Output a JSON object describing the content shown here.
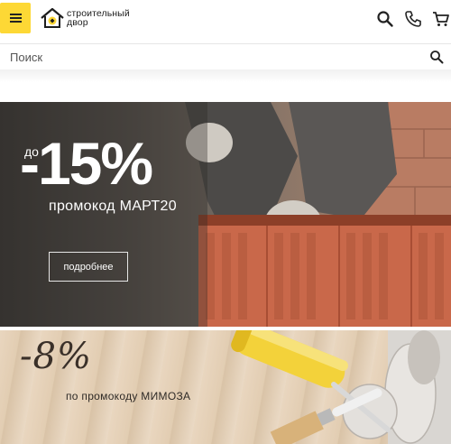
{
  "header": {
    "menu_icon": "hamburger-menu-icon",
    "logo_line1": "строительный",
    "logo_line2": "двор",
    "icons": [
      "search-icon",
      "phone-icon",
      "cart-icon"
    ],
    "accent_color": "#fdd835"
  },
  "search": {
    "placeholder": "Поиск",
    "icon": "search-icon"
  },
  "banner1": {
    "prefix": "до",
    "discount": "-15%",
    "promo": "промокод МАРТ20",
    "button_label": "подробнее"
  },
  "banner2": {
    "discount": "-8%",
    "promo": "по промокоду МИМОЗА"
  }
}
